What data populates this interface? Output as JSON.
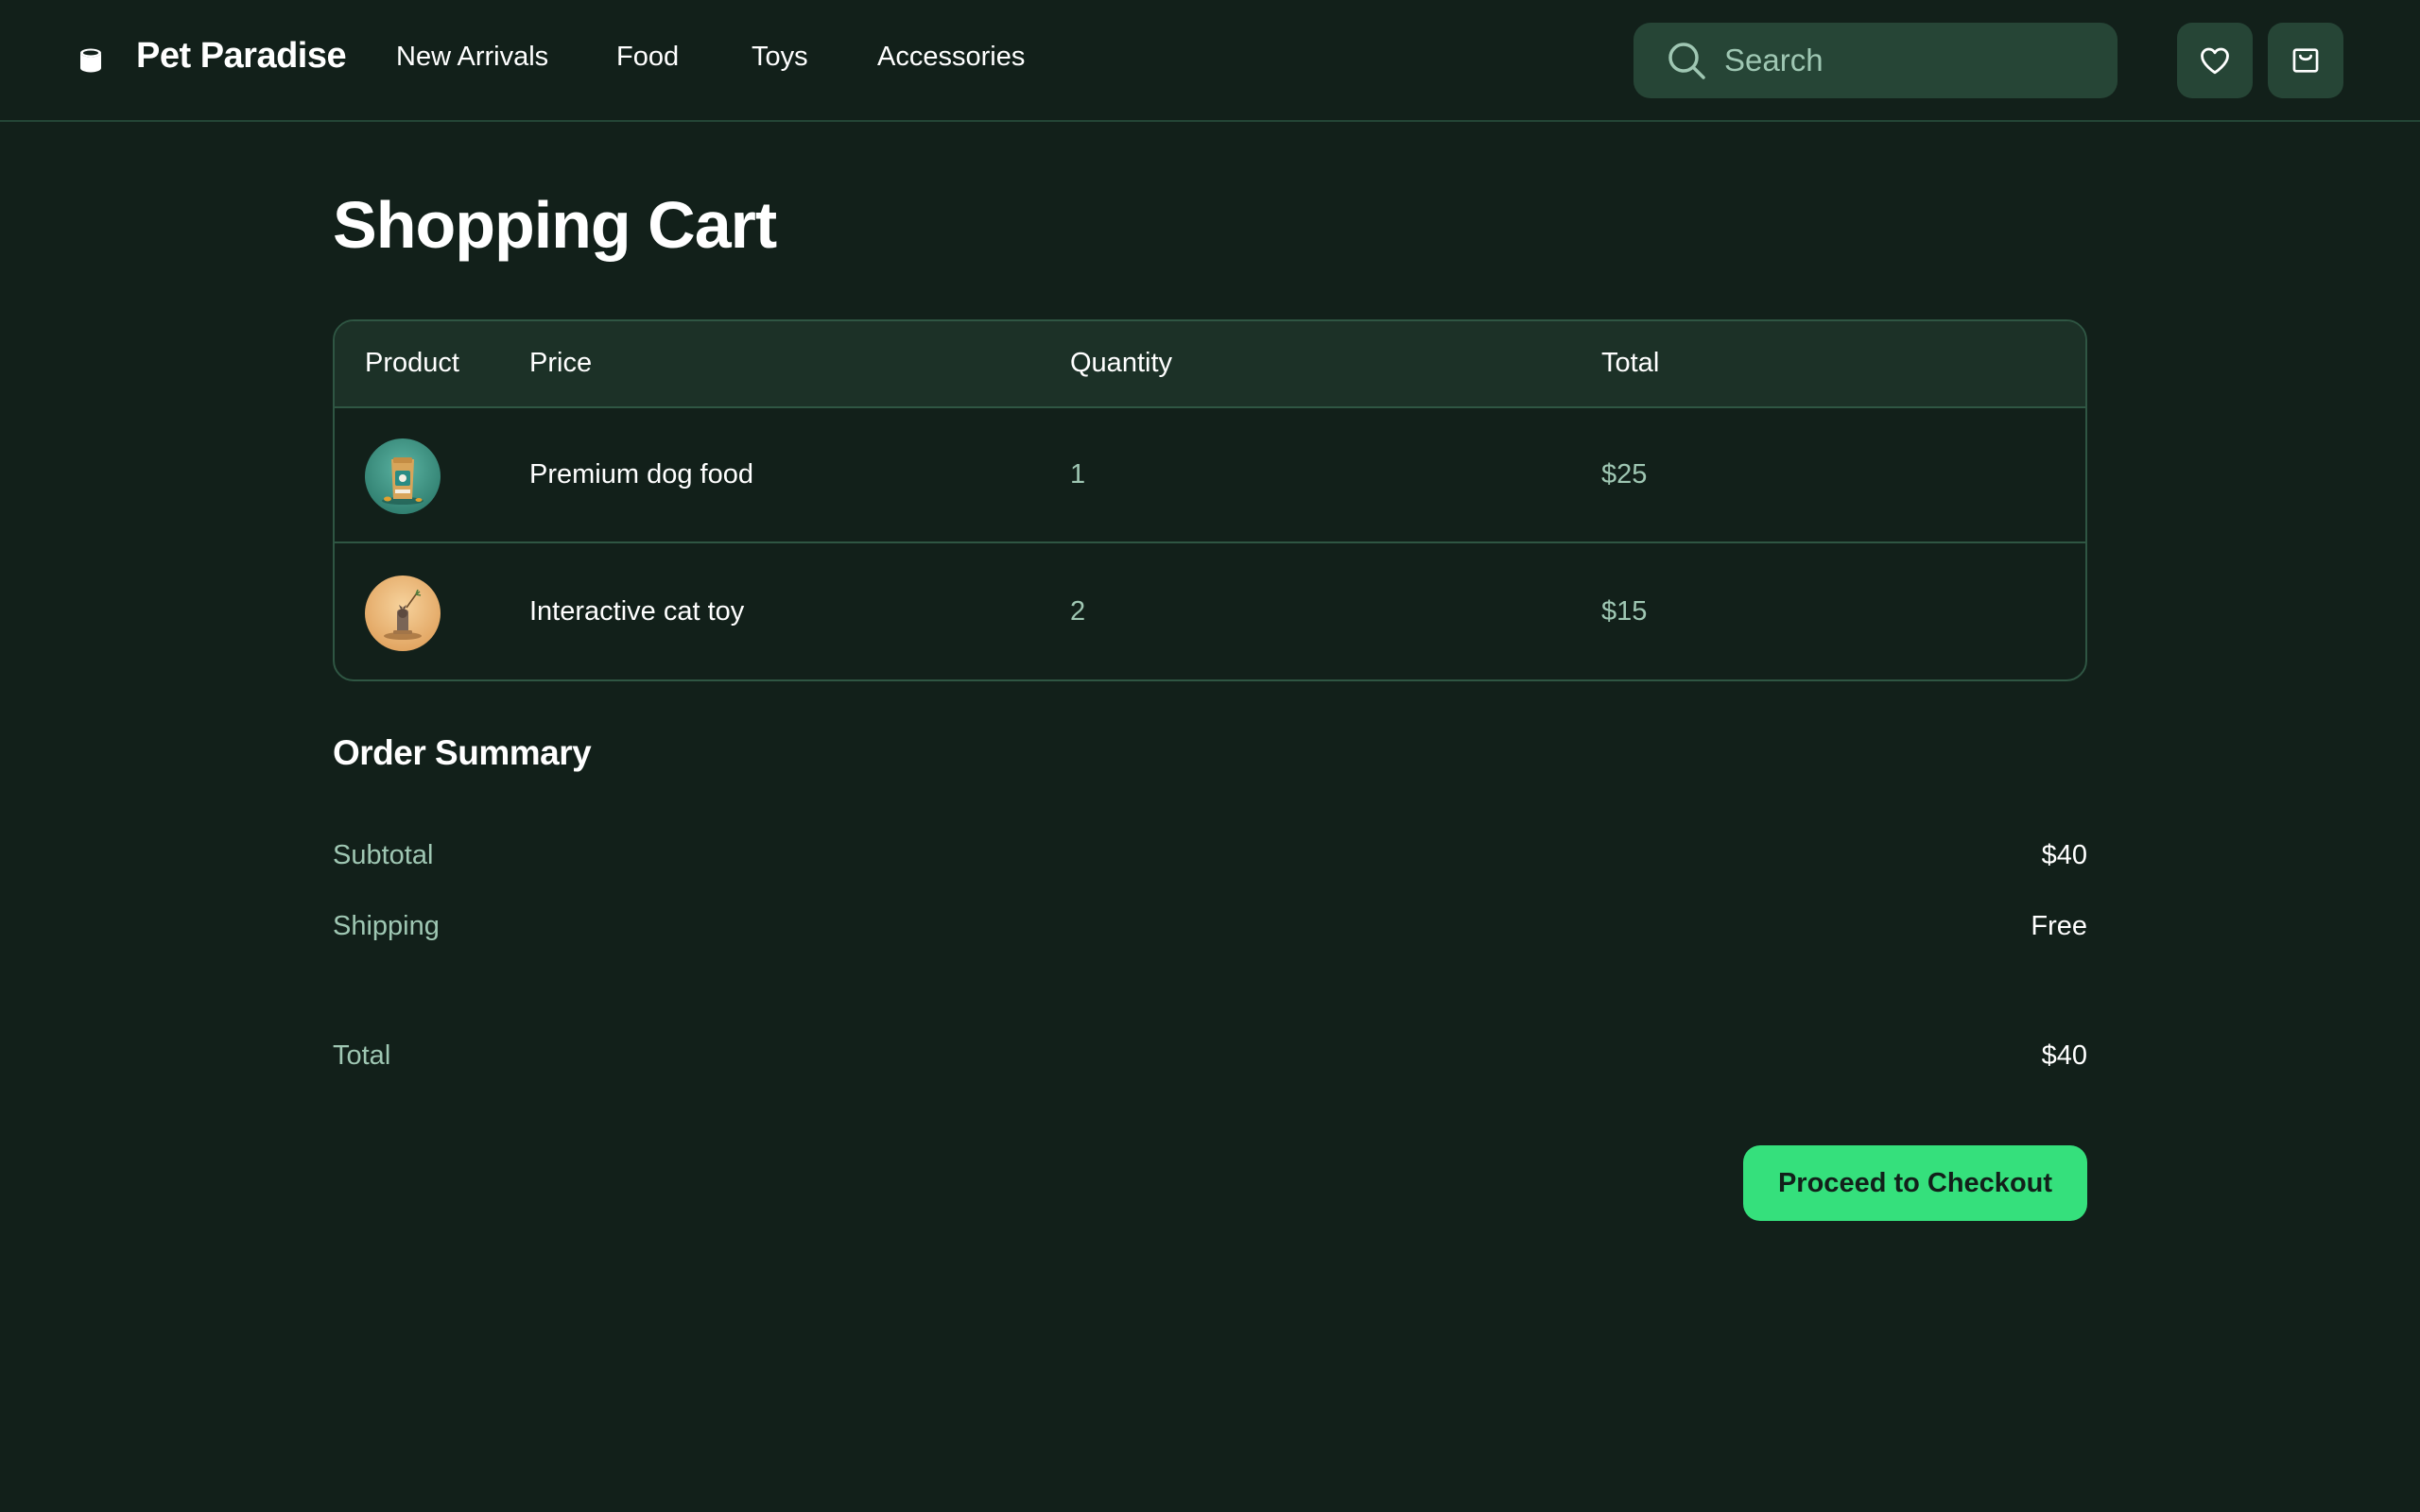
{
  "header": {
    "brand": "Pet Paradise",
    "logo_icon": "food-can-icon",
    "nav": [
      {
        "label": "New Arrivals"
      },
      {
        "label": "Food"
      },
      {
        "label": "Toys"
      },
      {
        "label": "Accessories"
      }
    ],
    "search": {
      "placeholder": "Search",
      "value": "",
      "icon": "search-icon"
    },
    "actions": [
      {
        "icon": "heart-icon"
      },
      {
        "icon": "shopping-bag-icon"
      }
    ]
  },
  "page": {
    "title": "Shopping Cart"
  },
  "cart": {
    "columns": [
      "Product",
      "Price",
      "Quantity",
      "Total"
    ],
    "items": [
      {
        "name": "Premium dog food",
        "quantity": "1",
        "total": "$25",
        "thumb": "dog-food-bag-image"
      },
      {
        "name": "Interactive cat toy",
        "quantity": "2",
        "total": "$15",
        "thumb": "cat-toy-image"
      }
    ]
  },
  "summary": {
    "title": "Order Summary",
    "subtotal_label": "Subtotal",
    "subtotal_value": "$40",
    "shipping_label": "Shipping",
    "shipping_value": "Free",
    "total_label": "Total",
    "total_value": "$40",
    "checkout_label": "Proceed to Checkout"
  },
  "colors": {
    "background": "#12201a",
    "surface": "#264536",
    "border": "#2f5643",
    "muted_text": "#9fc7b3",
    "accent": "#35e07c"
  }
}
